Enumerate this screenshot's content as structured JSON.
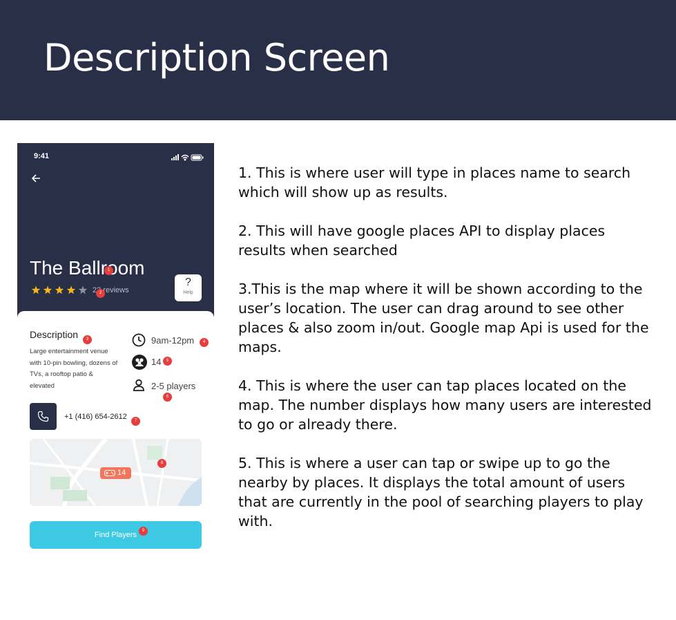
{
  "header": {
    "title": "Description Screen"
  },
  "phone": {
    "status_time": "9:41",
    "place_title": "The Ballroom",
    "rating": {
      "value": 4,
      "max": 5
    },
    "reviews_text": "22 reviews",
    "help": {
      "icon": "?",
      "label": "Help"
    },
    "description": {
      "title": "Description",
      "body": "Large entertainment venue with 10-pin bowling, dozens of TVs, a rooftop patio & elevated"
    },
    "hours": "9am-12pm",
    "interested_count": "14",
    "players": "2-5 players",
    "phone_number": "+1 (416) 654-2612",
    "map_pin_count": "14",
    "find_button": "Find Players",
    "markers": [
      "1",
      "2",
      "3",
      "4",
      "5",
      "6",
      "7",
      "8",
      "9"
    ]
  },
  "notes": [
    "1. This is where user will type in places name to search which will show up as results.",
    "2. This will have google places API to display places results when searched",
    "3.This is the map where it will be shown according to the user’s location. The user can drag around to see other places & also zoom in/out. Google map Api is used for the maps.",
    "4. This is where the user can tap places located on the map. The number displays how many users are interested to go or already there.",
    "5. This is where a user can tap or swipe up to go the nearby by places. It displays the total amount of users that are currently in the pool of searching players to play with."
  ],
  "colors": {
    "header_bg": "#2a2f48",
    "accent_cyan": "#3dc9e3",
    "pin_orange": "#f2765d",
    "star_gold": "#f6b51c",
    "marker_red": "#e63d3d"
  }
}
